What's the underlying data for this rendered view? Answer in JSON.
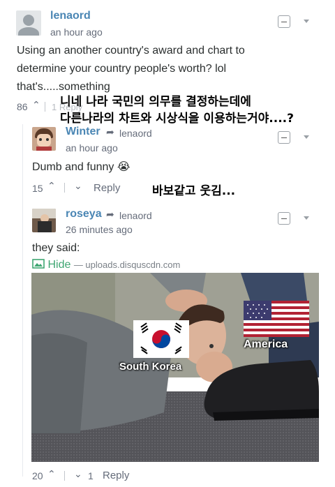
{
  "comments": [
    {
      "username": "lenaord",
      "timestamp": "an hour ago",
      "text_lines": [
        "Using an another country's award and chart to",
        "determine your country people's worth? lol",
        "that's.....something"
      ],
      "votes_up": "86",
      "faded_reply": "1 Reply"
    },
    {
      "username": "Winter",
      "reply_to": "lenaord",
      "timestamp": "an hour ago",
      "text": "Dumb and funny",
      "emoji": "😭",
      "votes_up": "15",
      "reply_label": "Reply"
    },
    {
      "username": "roseya",
      "reply_to": "lenaord",
      "timestamp": "26 minutes ago",
      "text": "they said:",
      "hide_label": "Hide",
      "hide_source": "— uploads.disquscdn.com",
      "votes_up": "20",
      "votes_down": "1",
      "reply_label": "Reply"
    }
  ],
  "overlay_korean": {
    "line1": "니네 나라 국민의 의무를 결정하는데에",
    "line2": "다른나라의 차트와 시상식을 이용하는거야....?",
    "line3": "바보같고 웃김..."
  },
  "meme": {
    "label_left": "South Korea",
    "label_right": "America"
  }
}
